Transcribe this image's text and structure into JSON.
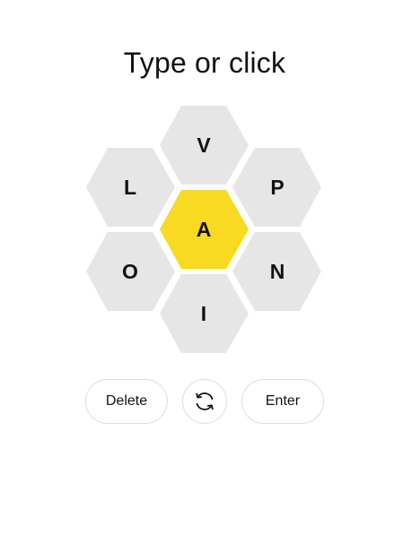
{
  "prompt": "Type or click",
  "letters": {
    "center": "A",
    "top": "V",
    "upper_left": "L",
    "upper_right": "P",
    "lower_left": "O",
    "lower_right": "N",
    "bottom": "I"
  },
  "colors": {
    "center_fill": "#f7da21",
    "outer_fill": "#e6e6e6"
  },
  "controls": {
    "delete_label": "Delete",
    "shuffle_icon": "shuffle-icon",
    "enter_label": "Enter"
  }
}
